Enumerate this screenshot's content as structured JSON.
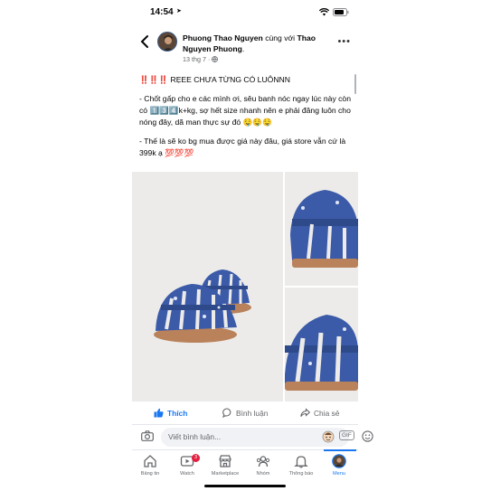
{
  "status_bar": {
    "time": "14:54"
  },
  "post": {
    "author": "Phuong Thao Nguyen",
    "with_text": "cùng với",
    "tagged": "Thao Nguyen Phuong",
    "tagged_suffix": ".",
    "date": "13 thg 7",
    "date_sep": "·",
    "paragraphs": [
      "‼️‼️‼️ RẸEE CHƯA TỪNG CÓ LUÔNNN",
      "- Chốt gấp cho e các mình ơi, sêu banh nóc ngay lúc này còn có 1️⃣3️⃣4️⃣k+kg, sợ hết size nhanh nên e phải đăng luôn cho nóng đây, dã man thực sự đó 🤤🤤🤤",
      "- Thế là sẽ ko bg mua được giá này đâu, giá store vẫn cứ là 399k ạ 💯💯💯"
    ]
  },
  "actions": {
    "like": "Thích",
    "comment": "Bình luận",
    "share": "Chia sẻ"
  },
  "comment_bar": {
    "placeholder": "Viết bình luận...",
    "gif_label": "GIF"
  },
  "tabs": [
    {
      "label": "Bảng tin",
      "icon": "home-icon"
    },
    {
      "label": "Watch",
      "icon": "watch-icon",
      "badge": "3"
    },
    {
      "label": "Marketplace",
      "icon": "marketplace-icon"
    },
    {
      "label": "Nhóm",
      "icon": "groups-icon"
    },
    {
      "label": "Thông báo",
      "icon": "bell-icon"
    },
    {
      "label": "Menu",
      "icon": "menu-avatar-icon",
      "active": true
    }
  ],
  "colors": {
    "accent": "#1877f2",
    "badge": "#e41e3f",
    "sandal_blue": "#3b5aa8",
    "sole": "#b9825a"
  }
}
